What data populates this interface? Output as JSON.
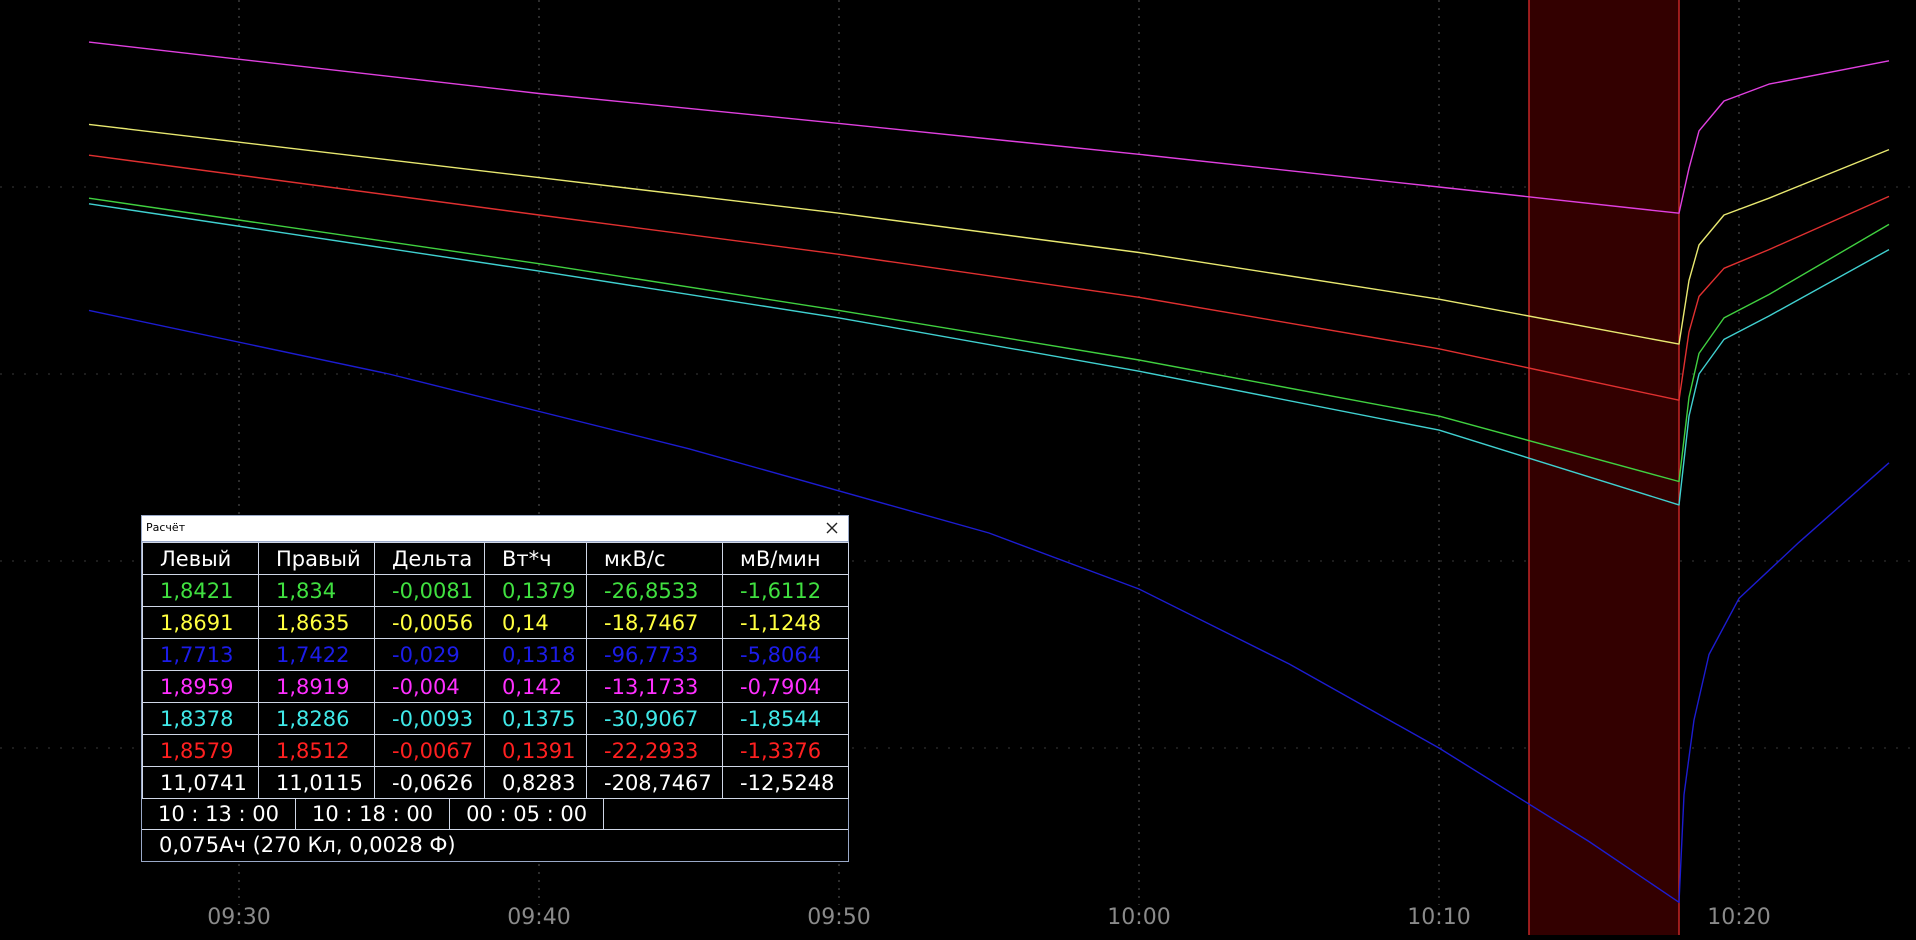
{
  "chart_data": {
    "type": "line",
    "x_axis": {
      "unit": "time",
      "range": [
        "09:25:00",
        "10:25:00"
      ],
      "ticks": [
        "09:30",
        "09:40",
        "09:50",
        "10:00",
        "10:10",
        "10:20"
      ]
    },
    "y_axis": {
      "range": [
        0,
        1
      ],
      "labels_shown": false
    },
    "grid": "dotted",
    "highlight_region": {
      "start": "10:13:00",
      "end": "10:18:00",
      "color": "#330000",
      "border_color": "#c42525"
    },
    "series": [
      {
        "color": "#e040e0",
        "points": [
          [
            "09:25:00",
            0.955
          ],
          [
            "09:40:00",
            0.9
          ],
          [
            "09:50:00",
            0.868
          ],
          [
            "10:00:00",
            0.835
          ],
          [
            "10:10:00",
            0.8
          ],
          [
            "10:18:00",
            0.772
          ],
          [
            "10:18:20",
            0.82
          ],
          [
            "10:18:40",
            0.86
          ],
          [
            "10:19:30",
            0.892
          ],
          [
            "10:21:00",
            0.91
          ],
          [
            "10:25:00",
            0.935
          ]
        ]
      },
      {
        "color": "#e8e870",
        "points": [
          [
            "09:25:00",
            0.867
          ],
          [
            "09:40:00",
            0.81
          ],
          [
            "09:50:00",
            0.772
          ],
          [
            "10:00:00",
            0.73
          ],
          [
            "10:10:00",
            0.68
          ],
          [
            "10:18:00",
            0.632
          ],
          [
            "10:18:20",
            0.7
          ],
          [
            "10:18:40",
            0.738
          ],
          [
            "10:19:30",
            0.77
          ],
          [
            "10:21:00",
            0.788
          ],
          [
            "10:25:00",
            0.84
          ]
        ]
      },
      {
        "color": "#e03030",
        "points": [
          [
            "09:25:00",
            0.834
          ],
          [
            "09:40:00",
            0.77
          ],
          [
            "09:50:00",
            0.728
          ],
          [
            "10:00:00",
            0.682
          ],
          [
            "10:10:00",
            0.627
          ],
          [
            "10:18:00",
            0.572
          ],
          [
            "10:18:20",
            0.645
          ],
          [
            "10:18:40",
            0.683
          ],
          [
            "10:19:30",
            0.713
          ],
          [
            "10:21:00",
            0.733
          ],
          [
            "10:25:00",
            0.79
          ]
        ]
      },
      {
        "color": "#40d040",
        "points": [
          [
            "09:25:00",
            0.788
          ],
          [
            "09:40:00",
            0.718
          ],
          [
            "09:50:00",
            0.668
          ],
          [
            "10:00:00",
            0.615
          ],
          [
            "10:10:00",
            0.555
          ],
          [
            "10:18:00",
            0.485
          ],
          [
            "10:18:20",
            0.575
          ],
          [
            "10:18:40",
            0.622
          ],
          [
            "10:19:30",
            0.66
          ],
          [
            "10:21:00",
            0.685
          ],
          [
            "10:25:00",
            0.76
          ]
        ]
      },
      {
        "color": "#40d0d0",
        "points": [
          [
            "09:25:00",
            0.782
          ],
          [
            "09:40:00",
            0.71
          ],
          [
            "09:50:00",
            0.66
          ],
          [
            "10:00:00",
            0.603
          ],
          [
            "10:10:00",
            0.54
          ],
          [
            "10:18:00",
            0.46
          ],
          [
            "10:18:20",
            0.555
          ],
          [
            "10:18:40",
            0.6
          ],
          [
            "10:19:30",
            0.637
          ],
          [
            "10:21:00",
            0.662
          ],
          [
            "10:25:00",
            0.733
          ]
        ]
      },
      {
        "color": "#1c1cd0",
        "points": [
          [
            "09:25:00",
            0.668
          ],
          [
            "09:35:00",
            0.6
          ],
          [
            "09:45:00",
            0.52
          ],
          [
            "09:55:00",
            0.43
          ],
          [
            "10:00:00",
            0.37
          ],
          [
            "10:05:00",
            0.29
          ],
          [
            "10:10:00",
            0.2
          ],
          [
            "10:15:00",
            0.1
          ],
          [
            "10:18:00",
            0.035
          ],
          [
            "10:18:10",
            0.15
          ],
          [
            "10:18:30",
            0.23
          ],
          [
            "10:19:00",
            0.3
          ],
          [
            "10:20:00",
            0.36
          ],
          [
            "10:22:00",
            0.42
          ],
          [
            "10:25:00",
            0.505
          ]
        ]
      }
    ]
  },
  "dialog": {
    "title": "Расчёт",
    "headers": [
      "Левый",
      "Правый",
      "Дельта",
      "Вт*ч",
      "мкВ/с",
      "мВ/мин"
    ],
    "rows": [
      {
        "color": "#40e040",
        "values": [
          "1,8421",
          "1,834",
          "-0,0081",
          "0,1379",
          "-26,8533",
          "-1,6112"
        ]
      },
      {
        "color": "#ffff40",
        "values": [
          "1,8691",
          "1,8635",
          "-0,0056",
          "0,14",
          "-18,7467",
          "-1,1248"
        ]
      },
      {
        "color": "#1c1ce8",
        "values": [
          "1,7713",
          "1,7422",
          "-0,029",
          "0,1318",
          "-96,7733",
          "-5,8064"
        ]
      },
      {
        "color": "#ff30ff",
        "values": [
          "1,8959",
          "1,8919",
          "-0,004",
          "0,142",
          "-13,1733",
          "-0,7904"
        ]
      },
      {
        "color": "#40e8e8",
        "values": [
          "1,8378",
          "1,8286",
          "-0,0093",
          "0,1375",
          "-30,9067",
          "-1,8544"
        ]
      },
      {
        "color": "#ff2020",
        "values": [
          "1,8579",
          "1,8512",
          "-0,0067",
          "0,1391",
          "-22,2933",
          "-1,3376"
        ]
      },
      {
        "color": "#ffffff",
        "values": [
          "11,0741",
          "11,0115",
          "-0,0626",
          "0,8283",
          "-208,7467",
          "-12,5248"
        ]
      }
    ],
    "times": [
      "10 : 13 : 00",
      "10 : 18 : 00",
      "00 : 05 : 00"
    ],
    "summary": "0,075Ач (270 Кл, 0,0028 Ф)"
  }
}
